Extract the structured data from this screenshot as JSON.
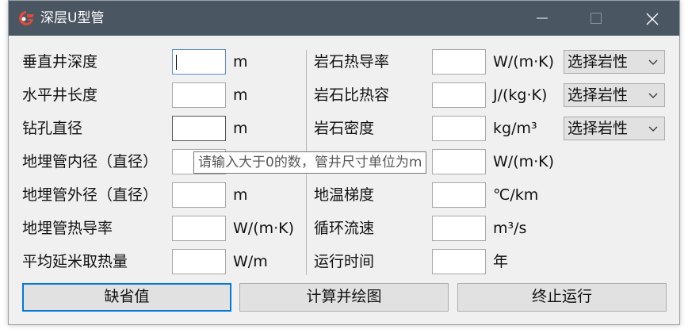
{
  "window": {
    "title": "深层U型管"
  },
  "left_params": [
    {
      "label": "垂直井深度",
      "unit": "m",
      "value": ""
    },
    {
      "label": "水平井长度",
      "unit": "m",
      "value": ""
    },
    {
      "label": "钻孔直径",
      "unit": "m",
      "value": ""
    },
    {
      "label": "地埋管内径（直径）",
      "unit": "",
      "value": ""
    },
    {
      "label": "地埋管外径（直径）",
      "unit": "m",
      "value": ""
    },
    {
      "label": "地埋管热导率",
      "unit": "W/(m·K)",
      "value": ""
    },
    {
      "label": "平均延米取热量",
      "unit": "W/m",
      "value": ""
    }
  ],
  "right_params": [
    {
      "label": "岩石热导率",
      "unit": "W/(m·K)",
      "value": "",
      "select": "选择岩性"
    },
    {
      "label": "岩石比热容",
      "unit": "J/(kg·K)",
      "value": "",
      "select": "选择岩性"
    },
    {
      "label": "岩石密度",
      "unit": "kg/m³",
      "value": "",
      "select": "选择岩性"
    },
    {
      "label": "",
      "unit": "W/(m·K)",
      "value": ""
    },
    {
      "label": "地温梯度",
      "unit": "℃/km",
      "value": ""
    },
    {
      "label": "循环流速",
      "unit": "m³/s",
      "value": ""
    },
    {
      "label": "运行时间",
      "unit": "年",
      "value": ""
    }
  ],
  "tooltip": "请输入大于0的数，管井尺寸单位为m",
  "buttons": {
    "default_label": "缺省值",
    "compute_label": "计算并绘图",
    "stop_label": "终止运行"
  },
  "colors": {
    "titlebar": "#4b5663",
    "accent": "#0078d7",
    "window_bg": "#f0f0f0"
  }
}
